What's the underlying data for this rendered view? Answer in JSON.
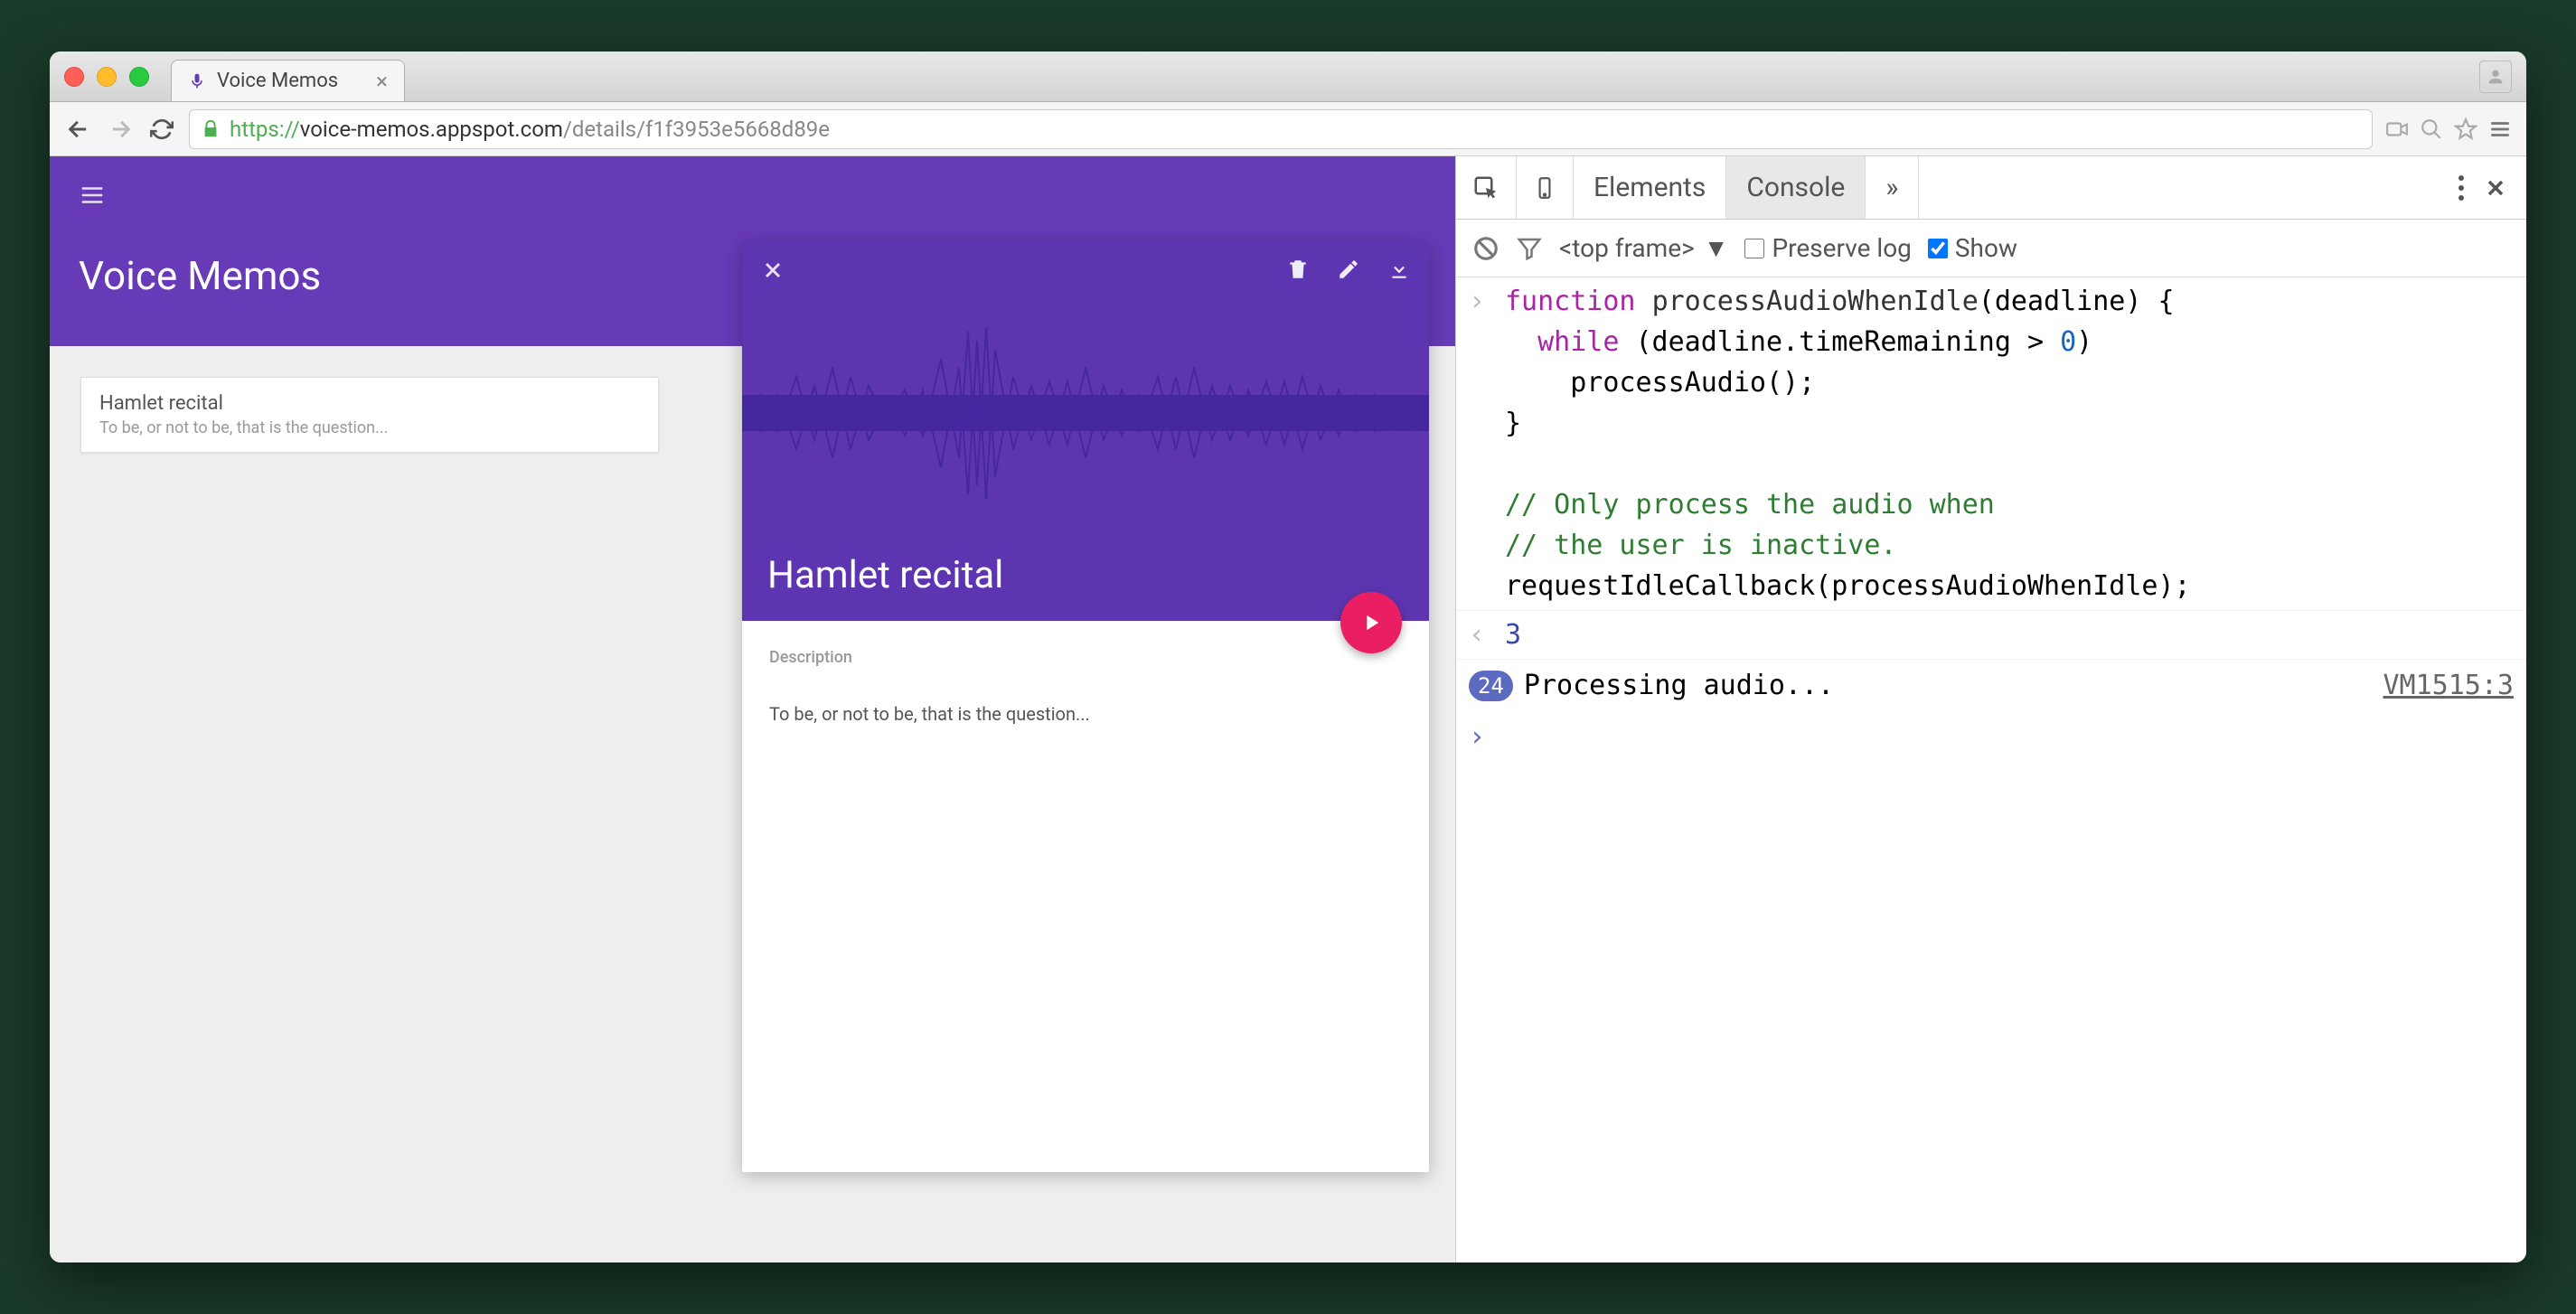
{
  "browser": {
    "tab_title": "Voice Memos",
    "url_protocol": "https://",
    "url_host": "voice-memos.appspot.com",
    "url_path": "/details/f1f3953e5668d89e"
  },
  "app": {
    "title": "Voice Memos",
    "list": [
      {
        "title": "Hamlet recital",
        "subtitle": "To be, or not to be, that is the question..."
      }
    ],
    "detail": {
      "title": "Hamlet recital",
      "description_label": "Description",
      "description": "To be, or not to be, that is the question..."
    }
  },
  "devtools": {
    "tabs": {
      "elements": "Elements",
      "console": "Console",
      "more": "»"
    },
    "active_tab": "Console",
    "frame_selector": "<top frame>",
    "preserve_log_label": "Preserve log",
    "preserve_log_checked": false,
    "show_label": "Show",
    "show_checked": true,
    "code": "function processAudioWhenIdle(deadline) {\n  while (deadline.timeRemaining > 0)\n    processAudio();\n}\n\n// Only process the audio when\n// the user is inactive.\nrequestIdleCallback(processAudioWhenIdle);",
    "return_value": "3",
    "log_count": "24",
    "log_msg": "Processing audio...",
    "log_src": "VM1515:3"
  }
}
